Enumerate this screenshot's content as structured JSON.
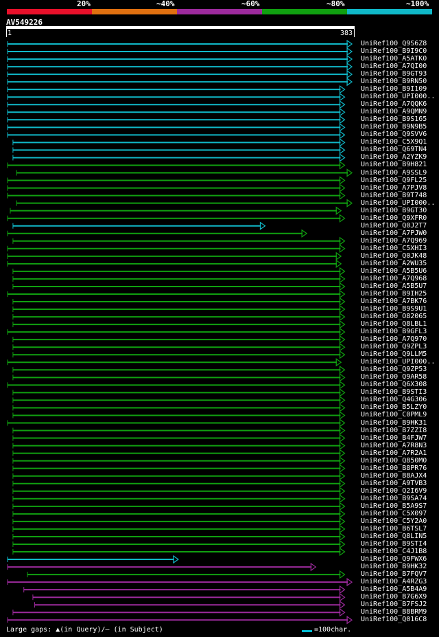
{
  "legend": {
    "labels": [
      "20%",
      "~40%",
      "~60%",
      "~80%",
      "~100%"
    ],
    "colors": [
      "#e8102a",
      "#e07010",
      "#9c2a9c",
      "#10a010",
      "#10b8c8"
    ]
  },
  "query": {
    "name": "AV549226",
    "start": "1",
    "end": "383"
  },
  "footer": {
    "gaps_text": "Large gaps: ▲(in Query)/— (in Subject)",
    "scale_text": "=100char."
  },
  "hits": [
    {
      "label": "UniRef100_Q9S6Z8",
      "color": "cyan",
      "s": 0,
      "e": 380
    },
    {
      "label": "UniRef100_B9I9C0",
      "color": "cyan",
      "s": 0,
      "e": 380
    },
    {
      "label": "UniRef100_A5ATK0",
      "color": "cyan",
      "s": 0,
      "e": 380
    },
    {
      "label": "UniRef100_A7QI00",
      "color": "cyan",
      "s": 0,
      "e": 380
    },
    {
      "label": "UniRef100_B9GT93",
      "color": "cyan",
      "s": 0,
      "e": 380
    },
    {
      "label": "UniRef100_B9RN50",
      "color": "cyan",
      "s": 0,
      "e": 380
    },
    {
      "label": "UniRef100_B9I109",
      "color": "cyan",
      "s": 0,
      "e": 372
    },
    {
      "label": "UniRef100_UPI000..",
      "color": "cyan",
      "s": 0,
      "e": 372
    },
    {
      "label": "UniRef100_A7QQK6",
      "color": "cyan",
      "s": 0,
      "e": 372
    },
    {
      "label": "UniRef100_A9QMN9",
      "color": "cyan",
      "s": 0,
      "e": 372
    },
    {
      "label": "UniRef100_B9S165",
      "color": "cyan",
      "s": 0,
      "e": 372
    },
    {
      "label": "UniRef100_B9N9B5",
      "color": "cyan",
      "s": 0,
      "e": 372
    },
    {
      "label": "UniRef100_Q9SVV6",
      "color": "cyan",
      "s": 0,
      "e": 372
    },
    {
      "label": "UniRef100_C5X9Q1",
      "color": "cyan",
      "s": 6,
      "e": 372
    },
    {
      "label": "UniRef100_Q69TN4",
      "color": "cyan",
      "s": 6,
      "e": 372
    },
    {
      "label": "UniRef100_A2YZK9",
      "color": "cyan",
      "s": 6,
      "e": 372
    },
    {
      "label": "UniRef100_B9H821",
      "color": "green",
      "s": 0,
      "e": 372
    },
    {
      "label": "UniRef100_A9SSL9",
      "color": "green",
      "s": 10,
      "e": 380
    },
    {
      "label": "UniRef100_Q9FL25",
      "color": "green",
      "s": 0,
      "e": 372
    },
    {
      "label": "UniRef100_A7PJV8",
      "color": "green",
      "s": 0,
      "e": 372
    },
    {
      "label": "UniRef100_B9T748",
      "color": "green",
      "s": 0,
      "e": 372
    },
    {
      "label": "UniRef100_UPI000..",
      "color": "green",
      "s": 10,
      "e": 380
    },
    {
      "label": "UniRef100_B9GT30",
      "color": "green",
      "s": 3,
      "e": 368
    },
    {
      "label": "UniRef100_Q9XFR0",
      "color": "green",
      "s": 0,
      "e": 372
    },
    {
      "label": "UniRef100_Q0J2T7",
      "color": "cyan",
      "s": 6,
      "e": 284
    },
    {
      "label": "UniRef100_A7PJW0",
      "color": "green",
      "s": 0,
      "e": 330
    },
    {
      "label": "UniRef100_A7Q969",
      "color": "green",
      "s": 6,
      "e": 372
    },
    {
      "label": "UniRef100_C5XHI3",
      "color": "green",
      "s": 0,
      "e": 372
    },
    {
      "label": "UniRef100_Q0JK48",
      "color": "green",
      "s": 0,
      "e": 368
    },
    {
      "label": "UniRef100_A2WU35",
      "color": "green",
      "s": 0,
      "e": 368
    },
    {
      "label": "UniRef100_A5B5U6",
      "color": "green",
      "s": 6,
      "e": 372
    },
    {
      "label": "UniRef100_A7Q968",
      "color": "green",
      "s": 6,
      "e": 372
    },
    {
      "label": "UniRef100_A5B5U7",
      "color": "green",
      "s": 6,
      "e": 372
    },
    {
      "label": "UniRef100_B9IH25",
      "color": "green",
      "s": 0,
      "e": 372
    },
    {
      "label": "UniRef100_A7BK76",
      "color": "green",
      "s": 6,
      "e": 372
    },
    {
      "label": "UniRef100_B9S9U1",
      "color": "green",
      "s": 6,
      "e": 372
    },
    {
      "label": "UniRef100_O82065",
      "color": "green",
      "s": 6,
      "e": 372
    },
    {
      "label": "UniRef100_Q8LBL1",
      "color": "green",
      "s": 6,
      "e": 372
    },
    {
      "label": "UniRef100_B9GFL3",
      "color": "green",
      "s": 0,
      "e": 372
    },
    {
      "label": "UniRef100_A7Q970",
      "color": "green",
      "s": 6,
      "e": 372
    },
    {
      "label": "UniRef100_Q9ZPL3",
      "color": "green",
      "s": 6,
      "e": 372
    },
    {
      "label": "UniRef100_Q9LLM5",
      "color": "green",
      "s": 6,
      "e": 372
    },
    {
      "label": "UniRef100_UPI000..",
      "color": "green",
      "s": 0,
      "e": 368
    },
    {
      "label": "UniRef100_Q9ZP53",
      "color": "green",
      "s": 6,
      "e": 372
    },
    {
      "label": "UniRef100_Q9AR58",
      "color": "green",
      "s": 6,
      "e": 372
    },
    {
      "label": "UniRef100_Q6X308",
      "color": "green",
      "s": 0,
      "e": 372
    },
    {
      "label": "UniRef100_B9STI3",
      "color": "green",
      "s": 6,
      "e": 372
    },
    {
      "label": "UniRef100_Q4G306",
      "color": "green",
      "s": 6,
      "e": 372
    },
    {
      "label": "UniRef100_B5LZY0",
      "color": "green",
      "s": 6,
      "e": 372
    },
    {
      "label": "UniRef100_C0PML9",
      "color": "green",
      "s": 6,
      "e": 372
    },
    {
      "label": "UniRef100_B9HK31",
      "color": "green",
      "s": 0,
      "e": 372
    },
    {
      "label": "UniRef100_B7ZZI8",
      "color": "green",
      "s": 6,
      "e": 372
    },
    {
      "label": "UniRef100_B4FJW7",
      "color": "green",
      "s": 6,
      "e": 372
    },
    {
      "label": "UniRef100_A7R8N3",
      "color": "green",
      "s": 6,
      "e": 372
    },
    {
      "label": "UniRef100_A7R2A1",
      "color": "green",
      "s": 6,
      "e": 372
    },
    {
      "label": "UniRef100_Q850M0",
      "color": "green",
      "s": 6,
      "e": 372
    },
    {
      "label": "UniRef100_B8PR76",
      "color": "green",
      "s": 6,
      "e": 372
    },
    {
      "label": "UniRef100_B8AJX4",
      "color": "green",
      "s": 6,
      "e": 372
    },
    {
      "label": "UniRef100_A9TVB3",
      "color": "green",
      "s": 6,
      "e": 372
    },
    {
      "label": "UniRef100_Q2I6V9",
      "color": "green",
      "s": 6,
      "e": 372
    },
    {
      "label": "UniRef100_B9SA74",
      "color": "green",
      "s": 6,
      "e": 372
    },
    {
      "label": "UniRef100_B5A9S7",
      "color": "green",
      "s": 6,
      "e": 372
    },
    {
      "label": "UniRef100_C5X097",
      "color": "green",
      "s": 6,
      "e": 372
    },
    {
      "label": "UniRef100_C5Y2A0",
      "color": "green",
      "s": 6,
      "e": 372
    },
    {
      "label": "UniRef100_B6TSL7",
      "color": "green",
      "s": 6,
      "e": 372
    },
    {
      "label": "UniRef100_Q8LIN5",
      "color": "green",
      "s": 6,
      "e": 372
    },
    {
      "label": "UniRef100_B9STI4",
      "color": "green",
      "s": 6,
      "e": 372
    },
    {
      "label": "UniRef100_C4J1B8",
      "color": "green",
      "s": 6,
      "e": 372
    },
    {
      "label": "UniRef100_Q9FWX6",
      "color": "cyan",
      "s": 0,
      "e": 188
    },
    {
      "label": "UniRef100_B9HK32",
      "color": "purple",
      "s": 0,
      "e": 340
    },
    {
      "label": "UniRef100_B7FQV7",
      "color": "green",
      "s": 22,
      "e": 372
    },
    {
      "label": "UniRef100_A4RZG3",
      "color": "purple",
      "s": 0,
      "e": 380
    },
    {
      "label": "UniRef100_A5B4A9",
      "color": "purple",
      "s": 18,
      "e": 372
    },
    {
      "label": "UniRef100_B7G6X9",
      "color": "purple",
      "s": 28,
      "e": 372
    },
    {
      "label": "UniRef100_B7FSJ2",
      "color": "purple",
      "s": 30,
      "e": 372
    },
    {
      "label": "UniRef100_B8BRM9",
      "color": "purple",
      "s": 6,
      "e": 372
    },
    {
      "label": "UniRef100_Q016C8",
      "color": "purple",
      "s": 0,
      "e": 380
    }
  ]
}
